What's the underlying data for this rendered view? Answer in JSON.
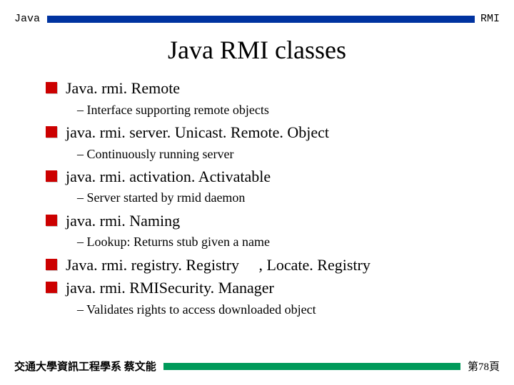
{
  "header": {
    "left": "Java",
    "right": "RMI"
  },
  "title": "Java RMI classes",
  "items": [
    {
      "text": "Java. rmi. Remote",
      "sub": "–   Interface supporting remote objects"
    },
    {
      "text": "java. rmi. server. Unicast. Remote. Object",
      "sub": "–   Continuously running server"
    },
    {
      "text": "java. rmi. activation. Activatable",
      "sub": "–   Server started by rmid daemon"
    },
    {
      "text": "java. rmi. Naming",
      "sub": "–   Lookup:  Returns stub given a name"
    },
    {
      "text": "Java. rmi. registry. Registry  ,   Locate. Registry",
      "sub": null
    },
    {
      "text": "java. rmi. RMISecurity. Manager",
      "sub": "–   Validates rights to access downloaded object"
    }
  ],
  "footer": {
    "left": "交通大學資訊工程學系 蔡文能",
    "right": "第78頁"
  }
}
